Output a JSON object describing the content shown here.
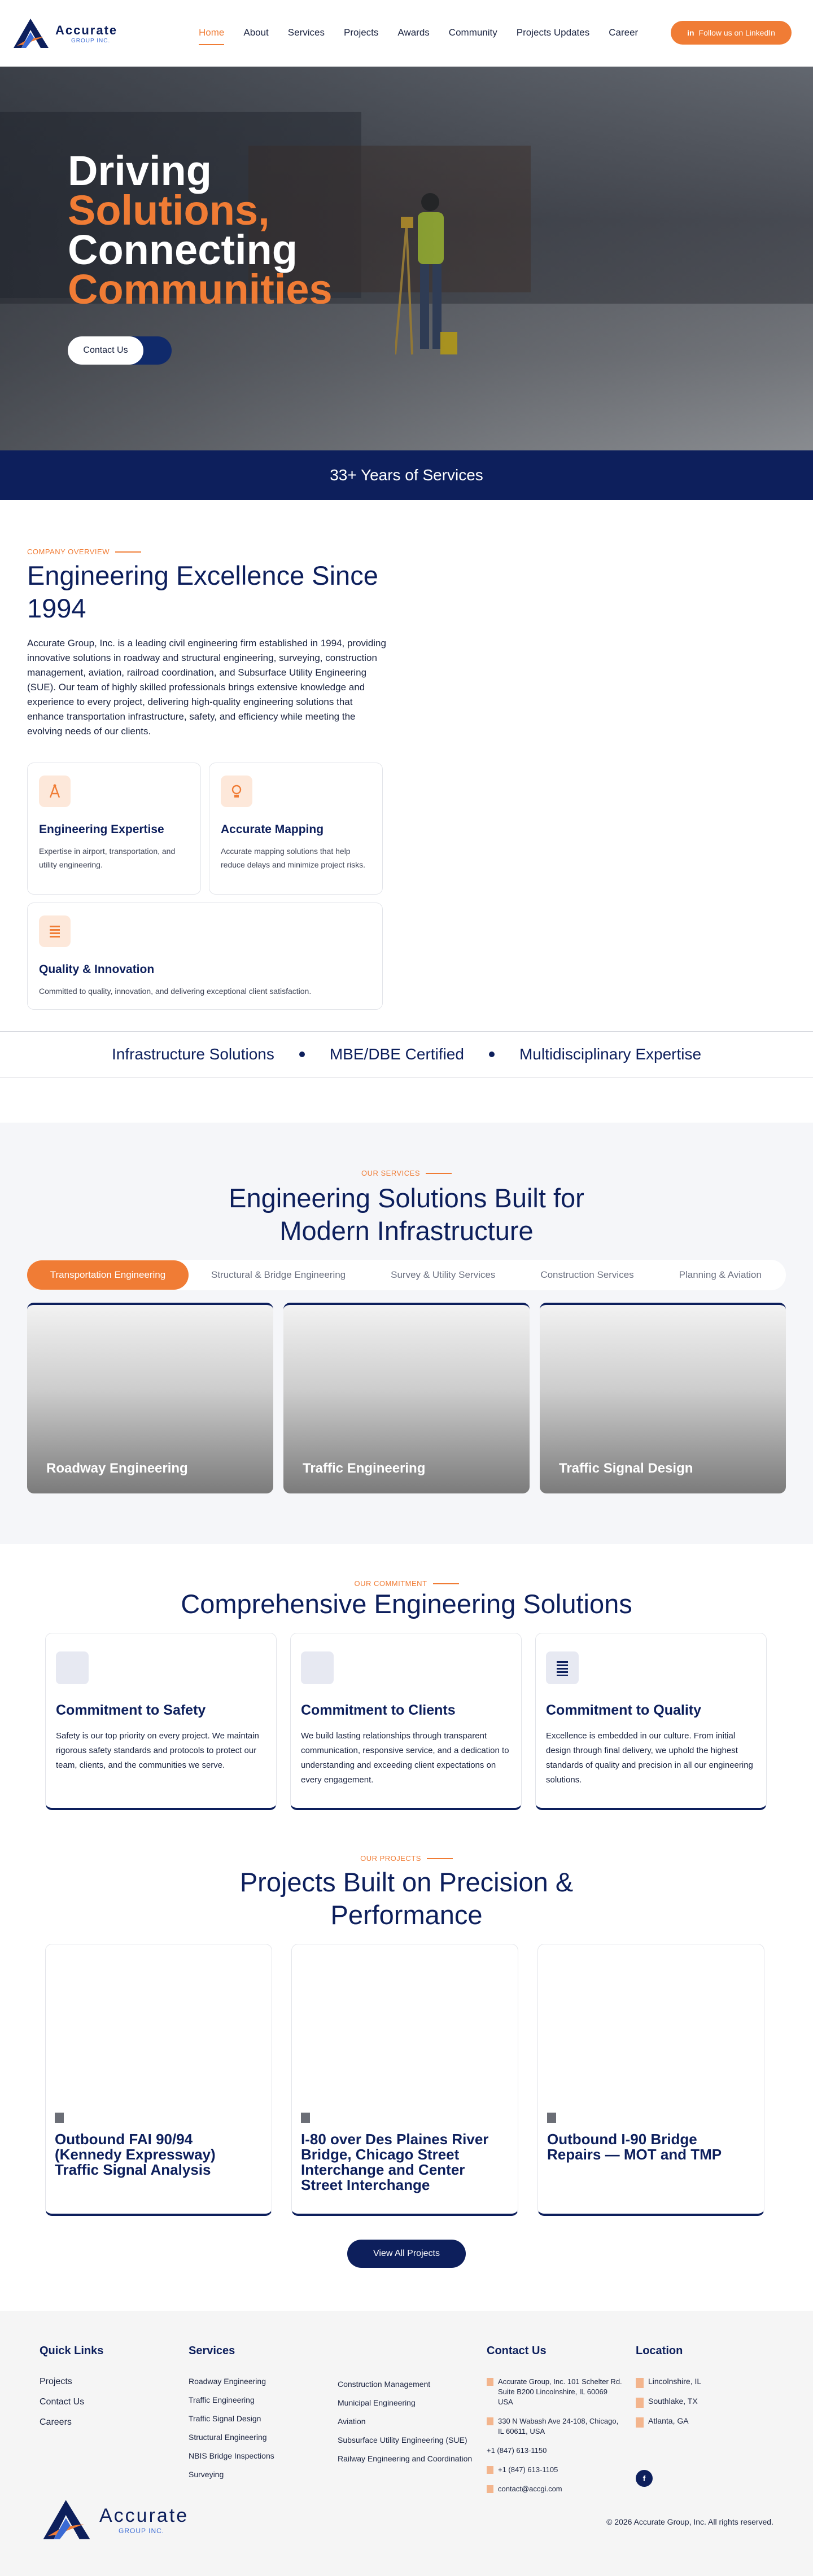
{
  "brand": {
    "name": "Accurate",
    "sub": "GROUP INC."
  },
  "nav": {
    "items": [
      "Home",
      "About",
      "Services",
      "Projects",
      "Awards",
      "Community",
      "Projects Updates",
      "Career"
    ],
    "linkedin": "Follow us on LinkedIn"
  },
  "hero": {
    "line1": "Driving",
    "line2": "Solutions,",
    "line3": "Connecting",
    "line4": "Communities",
    "cta": "Contact Us"
  },
  "years": "33+ Years of Services",
  "overview": {
    "eyebrow": "COMPANY OVERVIEW",
    "title": "Engineering Excellence Since 1994",
    "body": "Accurate Group, Inc. is a leading civil engineering firm established in 1994, providing innovative solutions in roadway and structural engineering, surveying, construction management, aviation, railroad coordination, and Subsurface Utility Engineering (SUE). Our team of highly skilled professionals brings extensive knowledge and experience to every project, delivering high-quality engineering solutions that enhance transportation infrastructure, safety, and efficiency while meeting the evolving needs of our clients.",
    "features": [
      {
        "title": "Engineering Expertise",
        "text": "Expertise in airport, transportation, and utility engineering."
      },
      {
        "title": "Accurate Mapping",
        "text": "Accurate mapping solutions that help reduce delays and minimize project risks."
      },
      {
        "title": "Quality & Innovation",
        "text": "Committed to quality, innovation, and delivering exceptional client satisfaction."
      }
    ]
  },
  "badges": [
    "Infrastructure Solutions",
    "MBE/DBE Certified",
    "Multidisciplinary Expertise"
  ],
  "services": {
    "eyebrow": "OUR SERVICES",
    "title_line1": "Engineering Solutions Built for",
    "title_line2": "Modern Infrastructure",
    "tabs": [
      "Transportation Engineering",
      "Structural & Bridge Engineering",
      "Survey & Utility Services",
      "Construction Services",
      "Planning & Aviation"
    ],
    "cards": [
      "Roadway Engineering",
      "Traffic Engineering",
      "Traffic Signal Design"
    ]
  },
  "commitment": {
    "eyebrow": "OUR COMMITMENT",
    "title": "Comprehensive Engineering Solutions",
    "cards": [
      {
        "title": "Commitment to Safety",
        "text": "Safety is our top priority on every project. We maintain rigorous safety standards and protocols to protect our team, clients, and the communities we serve."
      },
      {
        "title": "Commitment to Clients",
        "text": "We build lasting relationships through transparent communication, responsive service, and a dedication to understanding and exceeding client expectations on every engagement."
      },
      {
        "title": "Commitment to Quality",
        "text": "Excellence is embedded in our culture. From initial design through final delivery, we uphold the highest standards of quality and precision in all our engineering solutions."
      }
    ]
  },
  "projects": {
    "eyebrow": "OUR PROJECTS",
    "title_line1": "Projects Built on Precision &",
    "title_line2": "Performance",
    "cards": [
      "Outbound FAI 90/94 (Kennedy Expressway) Traffic Signal Analysis",
      "I-80 over Des Plaines River Bridge, Chicago Street Interchange and Center Street Interchange",
      "Outbound I-90 Bridge Repairs — MOT and TMP"
    ],
    "view_all": "View All Projects"
  },
  "footer": {
    "quick_links_title": "Quick Links",
    "quick_links": [
      "Projects",
      "Contact Us",
      "Careers"
    ],
    "services_title": "Services",
    "services_col1": [
      "Roadway Engineering",
      "Traffic Engineering",
      "Traffic Signal Design",
      "Structural Engineering",
      "NBIS Bridge Inspections",
      "Surveying"
    ],
    "services_col2": [
      "Construction Management",
      "Municipal Engineering",
      "Aviation",
      "Subsurface Utility Engineering (SUE)",
      "Railway Engineering and Coordination"
    ],
    "contact_title": "Contact Us",
    "contact": [
      "Accurate Group, Inc. 101 Schelter Rd. Suite B200 Lincolnshire, IL 60069 USA",
      "330 N Wabash Ave 24-108, Chicago, IL 60611, USA",
      "+1 (847) 613-1150",
      "+1 (847) 613-1105",
      "contact@accgi.com"
    ],
    "location_title": "Location",
    "locations": [
      "Lincolnshire, IL",
      "Southlake, TX",
      "Atlanta, GA"
    ],
    "copyright": "© 2026 Accurate Group, Inc. All rights reserved."
  },
  "colors": {
    "navy": "#0d1f5c",
    "orange": "#f07c35"
  },
  "icons": [
    "linkedin-icon",
    "compass-icon",
    "lightbulb-icon",
    "list-icon",
    "facebook-icon",
    "location-icon",
    "phone-icon",
    "mail-icon"
  ]
}
